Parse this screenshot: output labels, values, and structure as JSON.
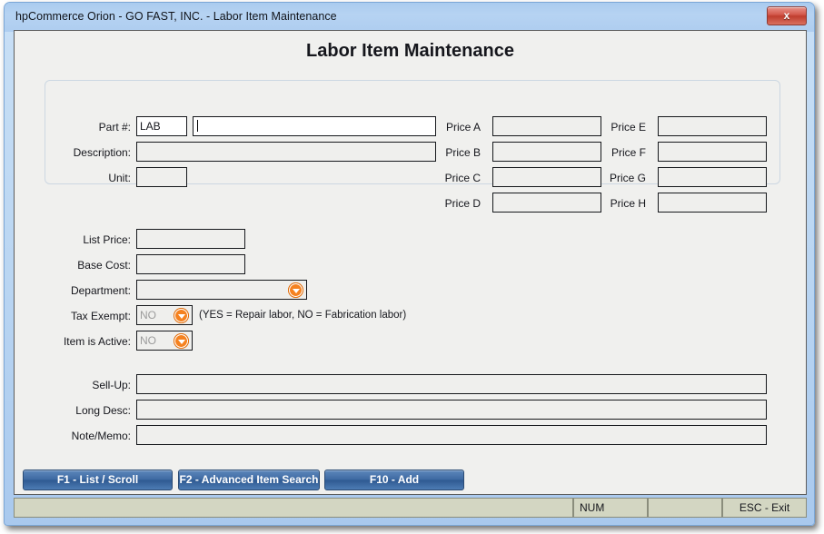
{
  "window": {
    "title": "hpCommerce Orion - GO FAST, INC. - Labor Item Maintenance",
    "close_label": "x"
  },
  "page": {
    "heading": "Labor Item Maintenance"
  },
  "top_group": {
    "part_label": "Part #:",
    "part_prefix_value": "LAB",
    "part_number_value": "",
    "description_label": "Description:",
    "description_value": "",
    "unit_label": "Unit:",
    "unit_value": "",
    "prices": [
      {
        "label": "Price A",
        "value": ""
      },
      {
        "label": "Price B",
        "value": ""
      },
      {
        "label": "Price C",
        "value": ""
      },
      {
        "label": "Price D",
        "value": ""
      },
      {
        "label": "Price E",
        "value": ""
      },
      {
        "label": "Price F",
        "value": ""
      },
      {
        "label": "Price G",
        "value": ""
      },
      {
        "label": "Price H",
        "value": ""
      }
    ]
  },
  "details": {
    "list_price_label": "List Price:",
    "list_price_value": "",
    "base_cost_label": "Base Cost:",
    "base_cost_value": "",
    "department_label": "Department:",
    "department_value": "",
    "tax_exempt_label": "Tax Exempt:",
    "tax_exempt_value": "NO",
    "tax_exempt_note": "(YES = Repair labor, NO = Fabrication labor)",
    "item_active_label": "Item is Active:",
    "item_active_value": "NO"
  },
  "memo": {
    "sell_up_label": "Sell-Up:",
    "sell_up_value": "",
    "long_desc_label": "Long Desc:",
    "long_desc_value": "",
    "note_memo_label": "Note/Memo:",
    "note_memo_value": ""
  },
  "buttons": [
    {
      "label": "F1 - List / Scroll"
    },
    {
      "label": "F2 - Advanced Item Search"
    },
    {
      "label": "F10 - Add"
    }
  ],
  "statusbar": {
    "panel_main": "",
    "panel_num": "NUM",
    "panel_blank": "",
    "panel_exit": "ESC - Exit"
  },
  "colors": {
    "titlebar": "#aecdf0",
    "frame": "#b9d5f2",
    "client_bg": "#f0f0ee",
    "field_bg": "#efefed",
    "field_active_bg": "#ffffff",
    "accent_orange": "#f58220",
    "button_blue": "#3f6ba3",
    "status_bg": "#d3d6c2"
  }
}
